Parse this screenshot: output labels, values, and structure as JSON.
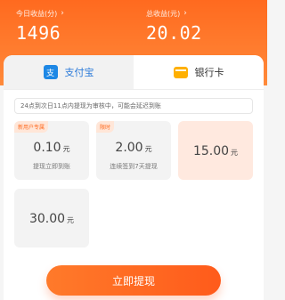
{
  "header": {
    "left": {
      "label": "今日收益(分)",
      "value": "1496"
    },
    "right": {
      "label": "总收益(元)",
      "value": "20.02"
    }
  },
  "tabs": [
    {
      "label": "支付宝",
      "icon": "alipay-icon",
      "active": false
    },
    {
      "label": "银行卡",
      "icon": "bank-card-icon",
      "active": true
    }
  ],
  "notice": "24点到次日11点内提现为审核中，可能会延迟到账",
  "options": [
    {
      "badge": "新用户专属",
      "amount": "0.10",
      "unit": "元",
      "desc": "提现立即到账"
    },
    {
      "badge": "限时",
      "amount": "2.00",
      "unit": "元",
      "desc": "连续签到7天提现"
    },
    {
      "badge": "",
      "amount": "15.00",
      "unit": "元",
      "desc": ""
    },
    {
      "badge": "",
      "amount": "30.00",
      "unit": "元",
      "desc": ""
    }
  ],
  "cta": {
    "label": "立即提现"
  },
  "colors": {
    "brand": "#ff6a1f",
    "selectedBg": "#ffe9df"
  }
}
